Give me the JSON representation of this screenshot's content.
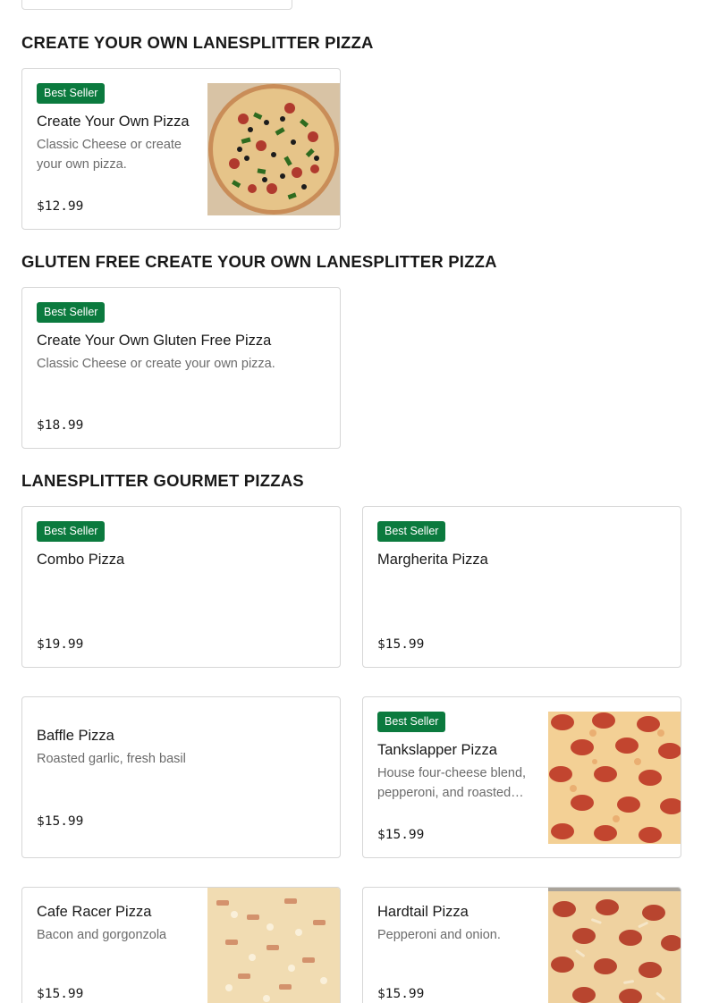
{
  "sections": [
    {
      "title": "CREATE YOUR OWN LANESPLITTER PIZZA",
      "items": [
        {
          "badge": "Best Seller",
          "name": "Create Your Own Pizza",
          "description": "Classic Cheese or create your own pizza.",
          "price": "$12.99",
          "image": "veggie-pizza-photo"
        }
      ]
    },
    {
      "title": "GLUTEN FREE CREATE YOUR OWN LANESPLITTER PIZZA",
      "items": [
        {
          "badge": "Best Seller",
          "name": "Create Your Own Gluten Free Pizza",
          "description": "Classic Cheese or create your own pizza.",
          "price": "$18.99"
        }
      ]
    },
    {
      "title": "LANESPLITTER GOURMET PIZZAS",
      "items": [
        {
          "badge": "Best Seller",
          "name": "Combo Pizza",
          "description": "",
          "price": "$19.99"
        },
        {
          "badge": "Best Seller",
          "name": "Margherita Pizza",
          "description": "",
          "price": "$15.99"
        },
        {
          "badge": "",
          "name": "Baffle Pizza",
          "description": "Roasted garlic, fresh basil",
          "price": "$15.99"
        },
        {
          "badge": "Best Seller",
          "name": "Tankslapper Pizza",
          "description": "House four-cheese blend, pepperoni, and roasted…",
          "price": "$15.99",
          "image": "pepperoni-pizza-photo"
        },
        {
          "badge": "",
          "name": "Cafe Racer Pizza",
          "description": "Bacon and gorgonzola",
          "price": "$15.99",
          "image": "bacon-pizza-photo"
        },
        {
          "badge": "",
          "name": "Hardtail Pizza",
          "description": "Pepperoni and onion.",
          "price": "$15.99",
          "image": "pepperoni-onion-pizza-photo"
        }
      ]
    }
  ],
  "colors": {
    "badge_bg": "#0b7a3e",
    "card_border": "#d6d6d6",
    "text": "#191919",
    "muted_text": "#6b6b6b"
  }
}
